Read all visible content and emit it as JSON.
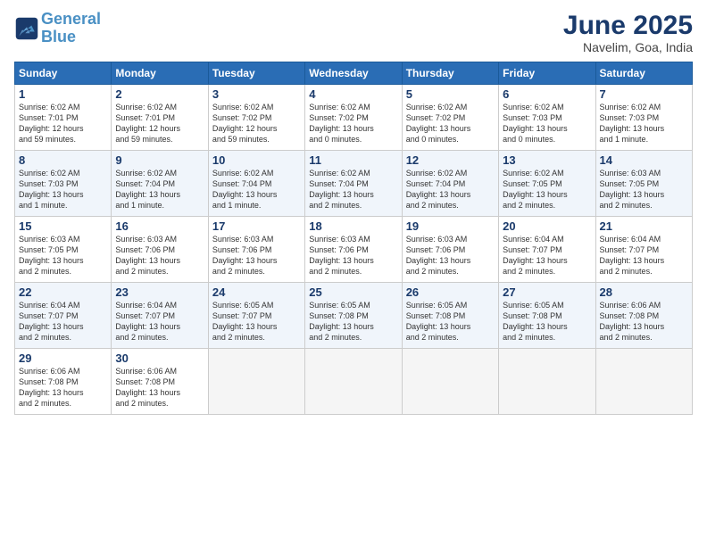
{
  "header": {
    "logo_line1": "General",
    "logo_line2": "Blue",
    "month": "June 2025",
    "location": "Navelim, Goa, India"
  },
  "weekdays": [
    "Sunday",
    "Monday",
    "Tuesday",
    "Wednesday",
    "Thursday",
    "Friday",
    "Saturday"
  ],
  "weeks": [
    [
      {
        "day": "1",
        "info": "Sunrise: 6:02 AM\nSunset: 7:01 PM\nDaylight: 12 hours\nand 59 minutes."
      },
      {
        "day": "2",
        "info": "Sunrise: 6:02 AM\nSunset: 7:01 PM\nDaylight: 12 hours\nand 59 minutes."
      },
      {
        "day": "3",
        "info": "Sunrise: 6:02 AM\nSunset: 7:02 PM\nDaylight: 12 hours\nand 59 minutes."
      },
      {
        "day": "4",
        "info": "Sunrise: 6:02 AM\nSunset: 7:02 PM\nDaylight: 13 hours\nand 0 minutes."
      },
      {
        "day": "5",
        "info": "Sunrise: 6:02 AM\nSunset: 7:02 PM\nDaylight: 13 hours\nand 0 minutes."
      },
      {
        "day": "6",
        "info": "Sunrise: 6:02 AM\nSunset: 7:03 PM\nDaylight: 13 hours\nand 0 minutes."
      },
      {
        "day": "7",
        "info": "Sunrise: 6:02 AM\nSunset: 7:03 PM\nDaylight: 13 hours\nand 1 minute."
      }
    ],
    [
      {
        "day": "8",
        "info": "Sunrise: 6:02 AM\nSunset: 7:03 PM\nDaylight: 13 hours\nand 1 minute."
      },
      {
        "day": "9",
        "info": "Sunrise: 6:02 AM\nSunset: 7:04 PM\nDaylight: 13 hours\nand 1 minute."
      },
      {
        "day": "10",
        "info": "Sunrise: 6:02 AM\nSunset: 7:04 PM\nDaylight: 13 hours\nand 1 minute."
      },
      {
        "day": "11",
        "info": "Sunrise: 6:02 AM\nSunset: 7:04 PM\nDaylight: 13 hours\nand 2 minutes."
      },
      {
        "day": "12",
        "info": "Sunrise: 6:02 AM\nSunset: 7:04 PM\nDaylight: 13 hours\nand 2 minutes."
      },
      {
        "day": "13",
        "info": "Sunrise: 6:02 AM\nSunset: 7:05 PM\nDaylight: 13 hours\nand 2 minutes."
      },
      {
        "day": "14",
        "info": "Sunrise: 6:03 AM\nSunset: 7:05 PM\nDaylight: 13 hours\nand 2 minutes."
      }
    ],
    [
      {
        "day": "15",
        "info": "Sunrise: 6:03 AM\nSunset: 7:05 PM\nDaylight: 13 hours\nand 2 minutes."
      },
      {
        "day": "16",
        "info": "Sunrise: 6:03 AM\nSunset: 7:06 PM\nDaylight: 13 hours\nand 2 minutes."
      },
      {
        "day": "17",
        "info": "Sunrise: 6:03 AM\nSunset: 7:06 PM\nDaylight: 13 hours\nand 2 minutes."
      },
      {
        "day": "18",
        "info": "Sunrise: 6:03 AM\nSunset: 7:06 PM\nDaylight: 13 hours\nand 2 minutes."
      },
      {
        "day": "19",
        "info": "Sunrise: 6:03 AM\nSunset: 7:06 PM\nDaylight: 13 hours\nand 2 minutes."
      },
      {
        "day": "20",
        "info": "Sunrise: 6:04 AM\nSunset: 7:07 PM\nDaylight: 13 hours\nand 2 minutes."
      },
      {
        "day": "21",
        "info": "Sunrise: 6:04 AM\nSunset: 7:07 PM\nDaylight: 13 hours\nand 2 minutes."
      }
    ],
    [
      {
        "day": "22",
        "info": "Sunrise: 6:04 AM\nSunset: 7:07 PM\nDaylight: 13 hours\nand 2 minutes."
      },
      {
        "day": "23",
        "info": "Sunrise: 6:04 AM\nSunset: 7:07 PM\nDaylight: 13 hours\nand 2 minutes."
      },
      {
        "day": "24",
        "info": "Sunrise: 6:05 AM\nSunset: 7:07 PM\nDaylight: 13 hours\nand 2 minutes."
      },
      {
        "day": "25",
        "info": "Sunrise: 6:05 AM\nSunset: 7:08 PM\nDaylight: 13 hours\nand 2 minutes."
      },
      {
        "day": "26",
        "info": "Sunrise: 6:05 AM\nSunset: 7:08 PM\nDaylight: 13 hours\nand 2 minutes."
      },
      {
        "day": "27",
        "info": "Sunrise: 6:05 AM\nSunset: 7:08 PM\nDaylight: 13 hours\nand 2 minutes."
      },
      {
        "day": "28",
        "info": "Sunrise: 6:06 AM\nSunset: 7:08 PM\nDaylight: 13 hours\nand 2 minutes."
      }
    ],
    [
      {
        "day": "29",
        "info": "Sunrise: 6:06 AM\nSunset: 7:08 PM\nDaylight: 13 hours\nand 2 minutes."
      },
      {
        "day": "30",
        "info": "Sunrise: 6:06 AM\nSunset: 7:08 PM\nDaylight: 13 hours\nand 2 minutes."
      },
      null,
      null,
      null,
      null,
      null
    ]
  ]
}
